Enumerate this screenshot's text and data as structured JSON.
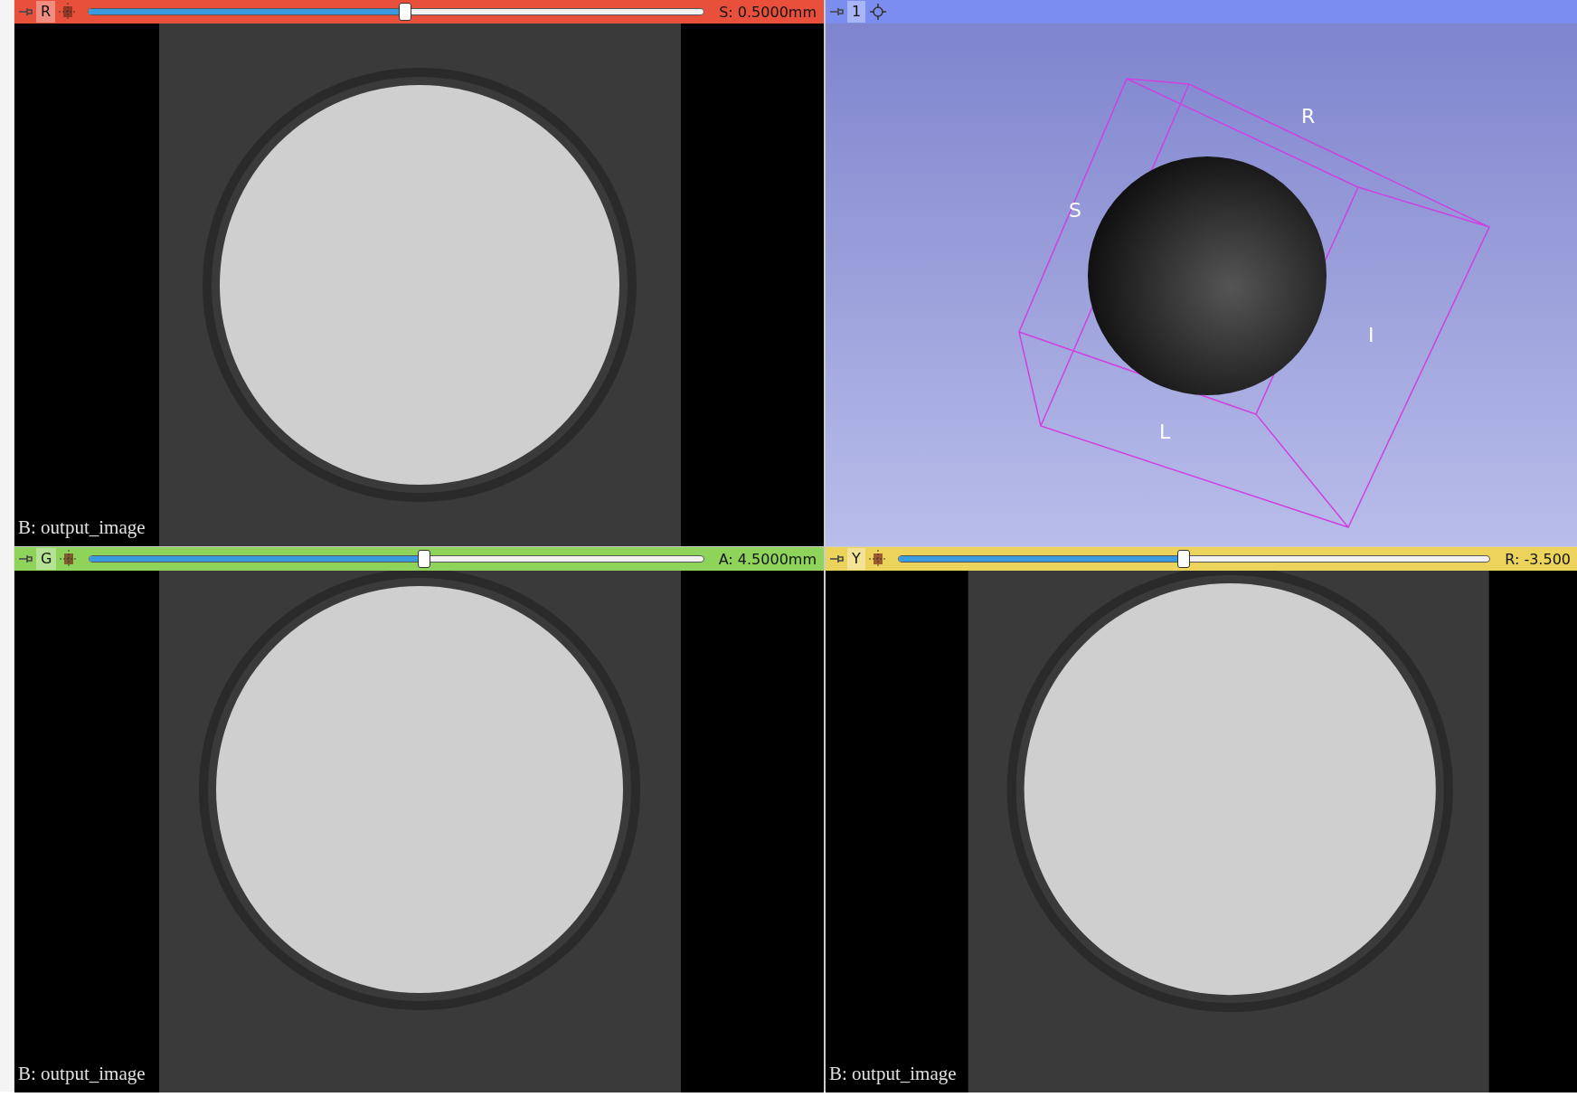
{
  "views": [
    {
      "kind": "slice",
      "color": "#e8503c",
      "letter": "R",
      "level": 0.504,
      "offset": "S: 0.5000mm",
      "overlay": "B: output_image"
    },
    {
      "kind": "volume",
      "color": "#7b8ef0",
      "letter": "1",
      "axis_labels": [
        "R",
        "S",
        "I",
        "L"
      ]
    },
    {
      "kind": "slice",
      "color": "#8ed45a",
      "letter": "G",
      "level": 0.535,
      "offset": "A: 4.5000mm",
      "overlay": "B: output_image"
    },
    {
      "kind": "slice",
      "color": "#ecd45c",
      "letter": "Y",
      "level": 0.472,
      "offset": "R: -3.500",
      "overlay": "B: output_image"
    }
  ]
}
